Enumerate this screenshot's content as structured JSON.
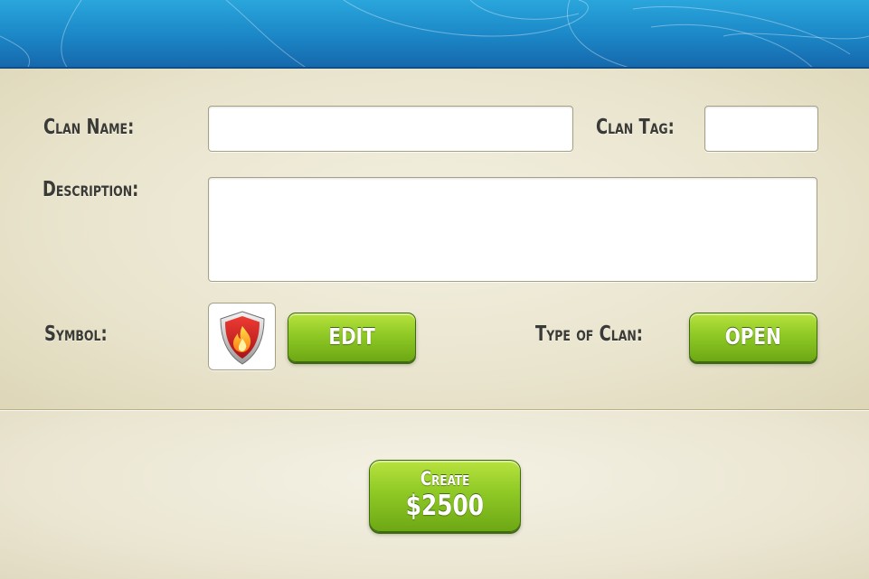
{
  "form": {
    "clan_name_label": "Clan Name:",
    "clan_name_value": "",
    "clan_tag_label": "Clan Tag:",
    "clan_tag_value": "",
    "description_label": "Description:",
    "description_value": "",
    "symbol_label": "Symbol:",
    "symbol_icon": "fire-shield-icon",
    "edit_button": "EDIT",
    "type_label": "Type of Clan:",
    "type_button": "OPEN"
  },
  "footer": {
    "create_label": "Create",
    "create_price": "$2500"
  },
  "colors": {
    "header_blue": "#1b86c6",
    "button_green": "#8fc925",
    "panel_beige": "#ece8d6",
    "shield_red": "#d42a2a"
  }
}
